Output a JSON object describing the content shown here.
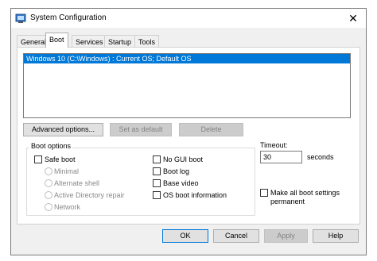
{
  "window": {
    "title": "System Configuration",
    "close_glyph": "✕"
  },
  "tabs": [
    {
      "label": "General",
      "active": false
    },
    {
      "label": "Boot",
      "active": true
    },
    {
      "label": "Services",
      "active": false
    },
    {
      "label": "Startup",
      "active": false
    },
    {
      "label": "Tools",
      "active": false
    }
  ],
  "os_list": {
    "items": [
      "Windows 10 (C:\\Windows) : Current OS; Default OS"
    ],
    "selected": 0
  },
  "list_buttons": {
    "advanced": "Advanced options...",
    "set_default": "Set as default",
    "delete": "Delete"
  },
  "boot_options": {
    "label": "Boot options",
    "safe_boot": {
      "label": "Safe boot",
      "checked": false
    },
    "safe_modes": [
      "Minimal",
      "Alternate shell",
      "Active Directory repair",
      "Network"
    ],
    "no_gui_boot": {
      "label": "No GUI boot",
      "checked": false
    },
    "boot_log": {
      "label": "Boot log",
      "checked": false
    },
    "base_video": {
      "label": "Base video",
      "checked": false
    },
    "os_boot_info": {
      "label": "OS boot information",
      "checked": false
    }
  },
  "timeout": {
    "label": "Timeout:",
    "value": "30",
    "unit": "seconds"
  },
  "permanent": {
    "label_line1": "Make all boot settings",
    "label_line2": "permanent",
    "checked": false
  },
  "footer": {
    "ok": "OK",
    "cancel": "Cancel",
    "apply": "Apply",
    "help": "Help"
  },
  "colors": {
    "selection": "#0078d7",
    "window_bg": "#f0f0f0"
  }
}
